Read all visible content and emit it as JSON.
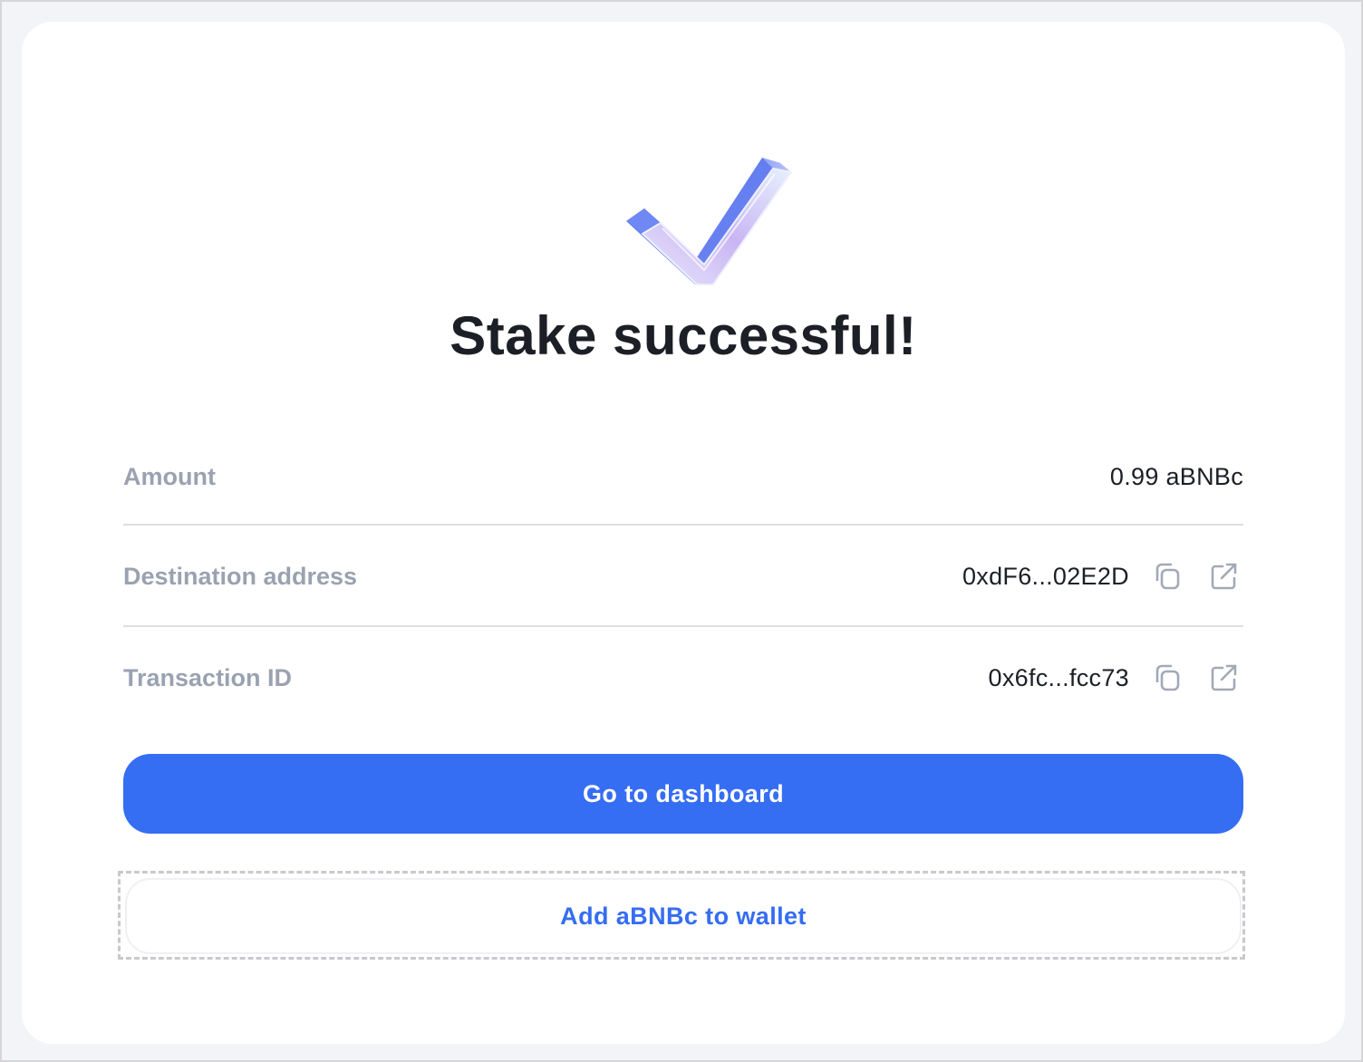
{
  "status": {
    "title": "Stake successful!",
    "icon": "checkmark-icon"
  },
  "details": [
    {
      "label": "Amount",
      "value": "0.99 aBNBc",
      "actions": []
    },
    {
      "label": "Destination address",
      "value": "0xdF6...02E2D",
      "actions": [
        "copy-icon",
        "external-link-icon"
      ]
    },
    {
      "label": "Transaction ID",
      "value": "0x6fc...fcc73",
      "actions": [
        "copy-icon",
        "external-link-icon"
      ]
    }
  ],
  "buttons": {
    "primary_label": "Go to dashboard",
    "secondary_label": "Add aBNBc to wallet"
  },
  "colors": {
    "accent": "#356df3",
    "title": "#1c1f26",
    "label": "#9aa2b1",
    "background": "#f3f4f8"
  }
}
